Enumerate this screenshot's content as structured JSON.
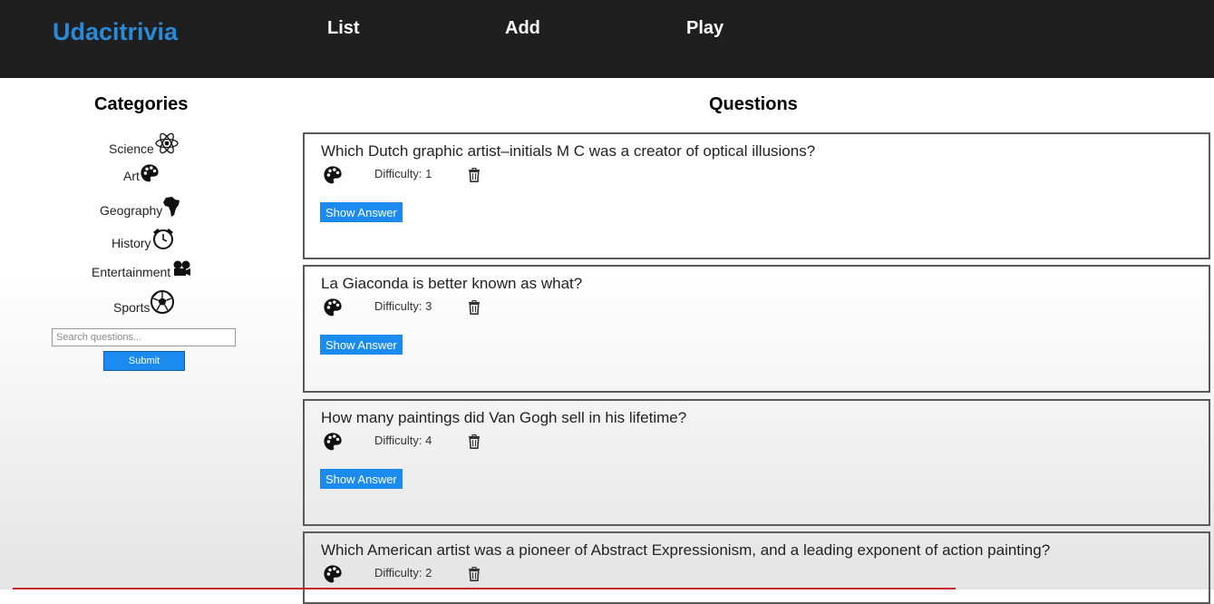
{
  "header": {
    "brand": "Udacitrivia",
    "nav": [
      "List",
      "Add",
      "Play"
    ]
  },
  "sidebar": {
    "title": "Categories",
    "categories": [
      {
        "label": "Science",
        "icon": "atom-icon"
      },
      {
        "label": "Art",
        "icon": "palette-icon"
      },
      {
        "label": "Geography",
        "icon": "africa-icon"
      },
      {
        "label": "History",
        "icon": "alarm-clock-icon"
      },
      {
        "label": "Entertainment",
        "icon": "film-camera-icon"
      },
      {
        "label": "Sports",
        "icon": "soccer-ball-icon"
      }
    ],
    "search": {
      "placeholder": "Search questions...",
      "value": ""
    },
    "submit_label": "Submit"
  },
  "main": {
    "title": "Questions",
    "questions": [
      {
        "text": "Which Dutch graphic artist–initials M C was a creator of optical illusions?",
        "category_icon": "palette-icon",
        "difficulty": "Difficulty: 1",
        "show_answer": "Show Answer"
      },
      {
        "text": "La Giaconda is better known as what?",
        "category_icon": "palette-icon",
        "difficulty": "Difficulty: 3",
        "show_answer": "Show Answer"
      },
      {
        "text": "How many paintings did Van Gogh sell in his lifetime?",
        "category_icon": "palette-icon",
        "difficulty": "Difficulty: 4",
        "show_answer": "Show Answer"
      },
      {
        "text": "Which American artist was a pioneer of Abstract Expressionism, and a leading exponent of action painting?",
        "category_icon": "palette-icon",
        "difficulty": "Difficulty: 2",
        "show_answer": ""
      }
    ]
  },
  "colors": {
    "brand": "#2a8ad8",
    "header_bg": "#1f1f1f",
    "button": "#1c8bef"
  }
}
